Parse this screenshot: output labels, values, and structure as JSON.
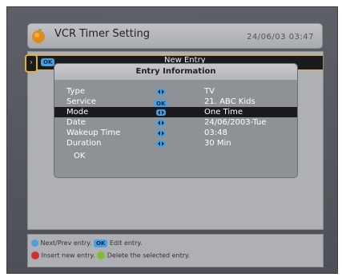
{
  "header": {
    "title": "VCR Timer Setting",
    "datetime": "24/06/03  03:47"
  },
  "list": {
    "selected_entry": {
      "ok_label": "OK",
      "title": "New Entry"
    }
  },
  "dialog": {
    "title": "Entry Information",
    "fields": [
      {
        "label": "Type",
        "control": "arrows",
        "value": "TV"
      },
      {
        "label": "Service",
        "control": "ok",
        "control_label": "OK",
        "value": "21. ABC Kids"
      },
      {
        "label": "Mode",
        "control": "arrows",
        "value": "One Time"
      },
      {
        "label": "Date",
        "control": "arrows",
        "value": "24/06/2003-Tue"
      },
      {
        "label": "Wakeup Time",
        "control": "arrows",
        "value": "03:48"
      },
      {
        "label": "Duration",
        "control": "arrows",
        "value": "30 Min"
      }
    ],
    "ok_label": "OK"
  },
  "help": {
    "line1_a": "Next/Prev entry.",
    "line1_ok": "OK",
    "line1_b": "Edit entry.",
    "line2_a": "Insert new entry.",
    "line2_b": "Delete the selected entry.",
    "red_color": "#d03030",
    "green_color": "#80c030"
  }
}
